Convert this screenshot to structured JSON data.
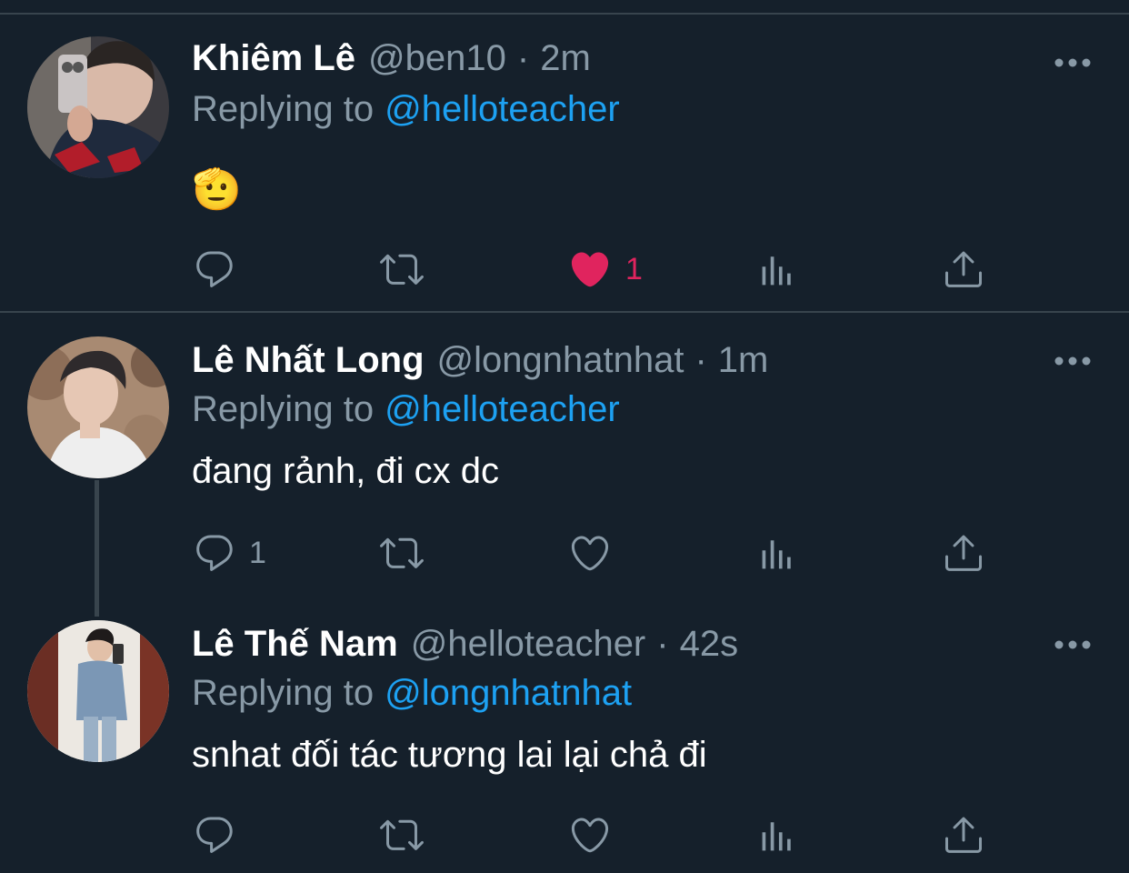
{
  "tweets": [
    {
      "name": "Khiêm Lê",
      "handle": "@ben10",
      "separator": "·",
      "time": "2m",
      "replying_label": "Replying to",
      "replying_to": "@helloteacher",
      "text": "🫡",
      "reply_count": "",
      "like_count": "1",
      "liked": true
    },
    {
      "name": "Lê Nhất Long",
      "handle": "@longnhatnhat",
      "separator": "·",
      "time": "1m",
      "replying_label": "Replying to",
      "replying_to": "@helloteacher",
      "text": "đang rảnh, đi cx dc",
      "reply_count": "1",
      "like_count": "",
      "liked": false
    },
    {
      "name": "Lê Thế Nam",
      "handle": "@helloteacher",
      "separator": "·",
      "time": "42s",
      "replying_label": "Replying to",
      "replying_to": "@longnhatnhat",
      "text": "snhat đối tác tương lai lại chả đi",
      "reply_count": "",
      "like_count": "",
      "liked": false
    }
  ],
  "icons": {
    "reply": "reply-icon",
    "retweet": "retweet-icon",
    "like": "heart-icon",
    "stats": "analytics-icon",
    "share": "share-icon",
    "more": "more-dots-icon"
  },
  "colors": {
    "background": "#15202b",
    "divider": "#38444d",
    "secondary_text": "#8899a6",
    "link": "#1da1f2",
    "like": "#e0245e"
  }
}
